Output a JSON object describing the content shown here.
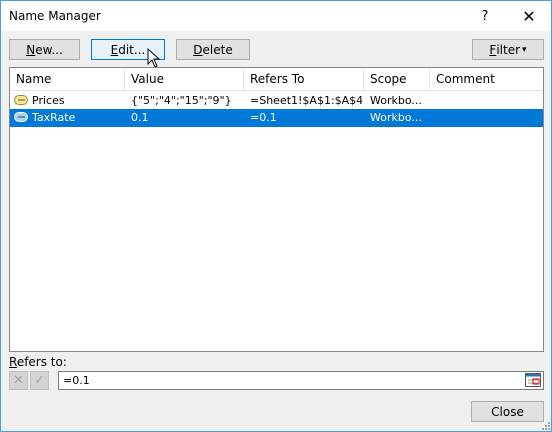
{
  "window": {
    "title": "Name Manager",
    "help_glyph": "?",
    "close_glyph": "✕"
  },
  "toolbar": {
    "new_prefix": "",
    "new_mnemonic": "N",
    "new_suffix": "ew...",
    "edit_prefix": "",
    "edit_mnemonic": "E",
    "edit_suffix": "dit...",
    "delete_prefix": "",
    "delete_mnemonic": "D",
    "delete_suffix": "elete",
    "filter_prefix": "",
    "filter_mnemonic": "F",
    "filter_suffix": "ilter",
    "filter_arrow": "▾"
  },
  "table": {
    "columns": [
      "Name",
      "Value",
      "Refers To",
      "Scope",
      "Comment"
    ],
    "rows": [
      {
        "name": "Prices",
        "value": "{\"5\";\"4\";\"15\";\"9\"}",
        "refers_to": "=Sheet1!$A$1:$A$4",
        "scope": "Workbo...",
        "comment": "",
        "selected": false
      },
      {
        "name": "TaxRate",
        "value": "0.1",
        "refers_to": "=0.1",
        "scope": "Workbo...",
        "comment": "",
        "selected": true
      }
    ]
  },
  "refers": {
    "label_mnemonic": "R",
    "label_rest": "efers to:",
    "value": "=0.1",
    "cancel_glyph": "✕",
    "confirm_glyph": "✓"
  },
  "footer": {
    "close_label": "Close"
  },
  "colors": {
    "accent": "#0078d7",
    "dialog_bg": "#f0f0f0",
    "frame": "#4a9be8"
  }
}
